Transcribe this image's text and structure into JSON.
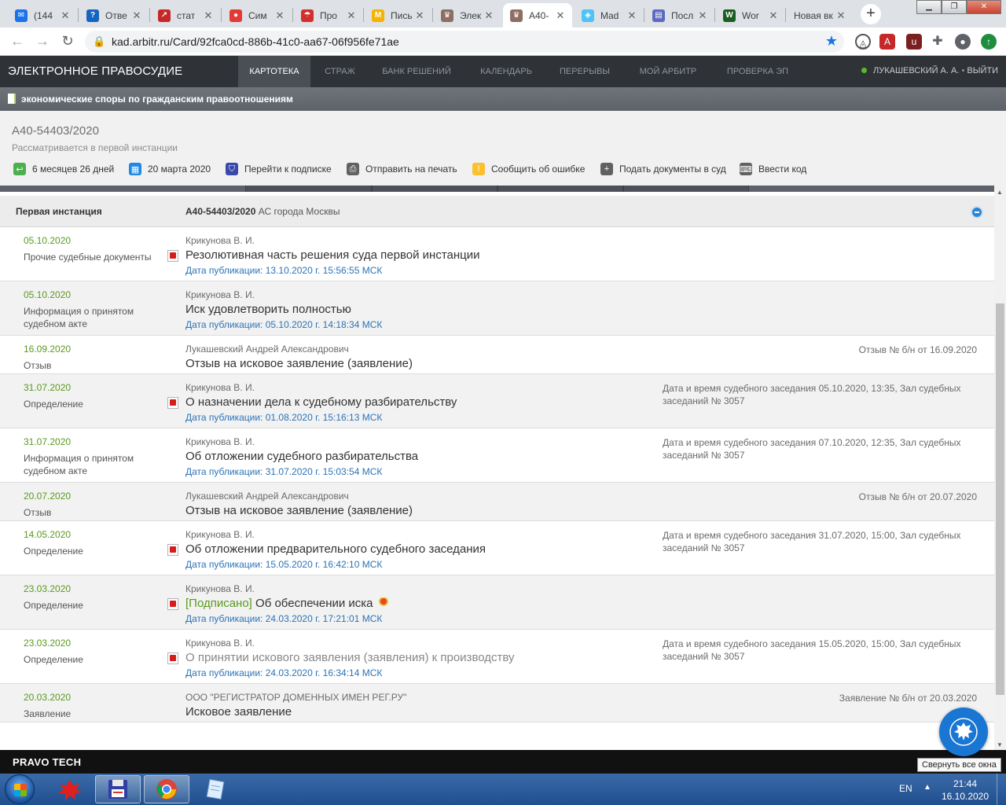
{
  "browser": {
    "tabs": [
      {
        "title": "(144",
        "color": "#1a73e8",
        "glyph": "✉"
      },
      {
        "title": "Отве",
        "color": "#1565c0",
        "glyph": "?"
      },
      {
        "title": "стат",
        "color": "#c62828",
        "glyph": "↗"
      },
      {
        "title": "Сим",
        "color": "#e53935",
        "glyph": "●"
      },
      {
        "title": "Про",
        "color": "#d32f2f",
        "glyph": "☂"
      },
      {
        "title": "Пись",
        "color": "#f4b400",
        "glyph": "M"
      },
      {
        "title": "Элек",
        "color": "#8d6e63",
        "glyph": "♛"
      },
      {
        "title": "А40-",
        "color": "#8d6e63",
        "glyph": "♛"
      },
      {
        "title": "Mad",
        "color": "#4fc3f7",
        "glyph": "◈"
      },
      {
        "title": "Посл",
        "color": "#5c6bc0",
        "glyph": "▤"
      },
      {
        "title": "Wor",
        "color": "#1b5e20",
        "glyph": "W"
      },
      {
        "title": "Новая вк",
        "color": "",
        "glyph": ""
      }
    ],
    "url": "kad.arbitr.ru/Card/92fca0cd-886b-41c0-aa67-06f956fe71ae"
  },
  "site": {
    "logo": "ЭЛЕКТРОННОЕ ПРАВОСУДИЕ",
    "nav": [
      "КАРТОТЕКА",
      "СТРАЖ",
      "БАНК РЕШЕНИЙ",
      "КАЛЕНДАРЬ",
      "ПЕРЕРЫВЫ",
      "МОЙ АРБИТР",
      "ПРОВЕРКА ЭП"
    ],
    "user": "ЛУКАШЕВСКИЙ А. А.",
    "logout": "ВЫЙТИ",
    "category": "экономические споры по гражданским правоотношениям"
  },
  "case": {
    "number": "А40-54403/2020",
    "status": "Рассматривается в первой инстанции",
    "actions": [
      {
        "label": "6 месяцев 26 дней",
        "icon": "clock-icon",
        "color": "#4caf50"
      },
      {
        "label": "20 марта 2020",
        "icon": "calendar-icon",
        "color": "#1e88e5"
      },
      {
        "label": "Перейти к подписке",
        "icon": "shield-icon",
        "color": "#3949ab"
      },
      {
        "label": "Отправить на печать",
        "icon": "printer-icon",
        "color": "#616161"
      },
      {
        "label": "Сообщить об ошибке",
        "icon": "warning-icon",
        "color": "#fbc02d"
      },
      {
        "label": "Подать документы в суд",
        "icon": "plus-circle-icon",
        "color": "#616161"
      },
      {
        "label": "Ввести код",
        "icon": "keyboard-icon",
        "color": "#616161"
      }
    ]
  },
  "instance": {
    "label": "Первая инстанция",
    "case_ref": "А40-54403/2020",
    "court": "АС города Москвы"
  },
  "rows": [
    {
      "date": "05.10.2020",
      "type": "Прочие судебные документы",
      "pdf": true,
      "judge": "Крикунова В. И.",
      "title": "Резолютивная часть решения суда первой инстанции",
      "signed": "",
      "pub": "Дата публикации: 13.10.2020 г. 15:56:55 МСК",
      "extra": ""
    },
    {
      "date": "05.10.2020",
      "type": "Информация о принятом судебном акте",
      "pdf": false,
      "judge": "Крикунова В. И.",
      "title": "Иск удовлетворить полностью",
      "signed": "",
      "pub": "Дата публикации: 05.10.2020 г. 14:18:34 МСК",
      "extra": ""
    },
    {
      "date": "16.09.2020",
      "type": "Отзыв",
      "pdf": false,
      "judge": "Лукашевский Андрей Александрович",
      "title": "Отзыв на исковое заявление (заявление)",
      "signed": "",
      "pub": "",
      "extra": "Отзыв № б/н от 16.09.2020"
    },
    {
      "date": "31.07.2020",
      "type": "Определение",
      "pdf": true,
      "judge": "Крикунова В. И.",
      "title": "О назначении дела к судебному разбирательству",
      "signed": "",
      "pub": "Дата публикации: 01.08.2020 г. 15:16:13 МСК",
      "extra": "Дата и время судебного заседания 05.10.2020, 13:35, Зал судебных заседаний № 3057"
    },
    {
      "date": "31.07.2020",
      "type": "Информация о принятом судебном акте",
      "pdf": false,
      "judge": "Крикунова В. И.",
      "title": "Об отложении судебного разбирательства",
      "signed": "",
      "pub": "Дата публикации: 31.07.2020 г. 15:03:54 МСК",
      "extra": "Дата и время судебного заседания 07.10.2020, 12:35, Зал судебных заседаний № 3057"
    },
    {
      "date": "20.07.2020",
      "type": "Отзыв",
      "pdf": false,
      "judge": "Лукашевский Андрей Александрович",
      "title": "Отзыв на исковое заявление (заявление)",
      "signed": "",
      "pub": "",
      "extra": "Отзыв № б/н от 20.07.2020"
    },
    {
      "date": "14.05.2020",
      "type": "Определение",
      "pdf": true,
      "judge": "Крикунова В. И.",
      "title": "Об отложении предварительного судебного заседания",
      "signed": "",
      "pub": "Дата публикации: 15.05.2020 г. 16:42:10 МСК",
      "extra": "Дата и время судебного заседания 31.07.2020, 15:00, Зал судебных заседаний № 3057"
    },
    {
      "date": "23.03.2020",
      "type": "Определение",
      "pdf": true,
      "judge": "Крикунова В. И.",
      "title": "Об обеспечении иска",
      "signed": "[Подписано]",
      "pub": "Дата публикации: 24.03.2020 г. 17:21:01 МСК",
      "extra": ""
    },
    {
      "date": "23.03.2020",
      "type": "Определение",
      "pdf": true,
      "judge": "Крикунова В. И.",
      "title": "О принятии искового заявления (заявления) к производству",
      "signed": "",
      "pub": "Дата публикации: 24.03.2020 г. 16:34:14 МСК",
      "extra": "Дата и время судебного заседания 15.05.2020, 15:00, Зал судебных заседаний № 3057"
    },
    {
      "date": "20.03.2020",
      "type": "Заявление",
      "pdf": false,
      "judge": "ООО \"РЕГИСТРАТОР ДОМЕННЫХ ИМЕН РЕГ.РУ\"",
      "title": "Исковое заявление",
      "signed": "",
      "pub": "",
      "extra": "Заявление № б/н от 20.03.2020"
    }
  ],
  "footer": {
    "brand": "PRAVO TECH",
    "tooltip": "Свернуть все окна"
  },
  "taskbar": {
    "lang": "EN",
    "time": "21:44",
    "date": "16.10.2020"
  }
}
